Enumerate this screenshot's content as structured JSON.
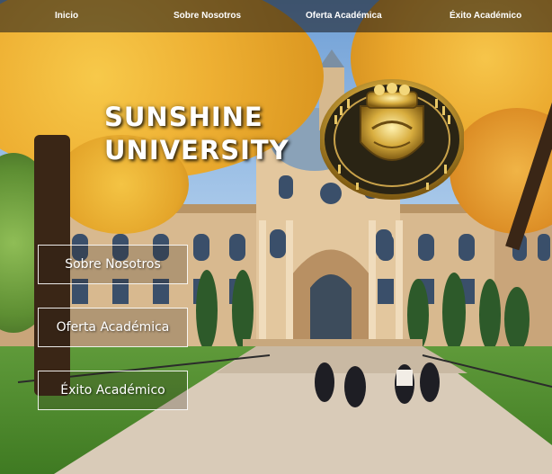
{
  "nav": {
    "items": [
      {
        "label": "Inicio"
      },
      {
        "label": "Sobre Nosotros"
      },
      {
        "label": "Oferta Académica"
      },
      {
        "label": "Éxito Académico"
      }
    ]
  },
  "hero": {
    "title_line1": "SUNSHINE",
    "title_line2": "UNIVERSITY",
    "crest": {
      "icon": "university-crest-icon"
    }
  },
  "side_menu": {
    "buttons": [
      {
        "label": "Sobre Nosotros"
      },
      {
        "label": "Oferta Académica"
      },
      {
        "label": "Éxito Académico"
      }
    ]
  },
  "colors": {
    "nav_background": "#141418",
    "text": "#ffffff",
    "foliage": "#f2b531"
  }
}
